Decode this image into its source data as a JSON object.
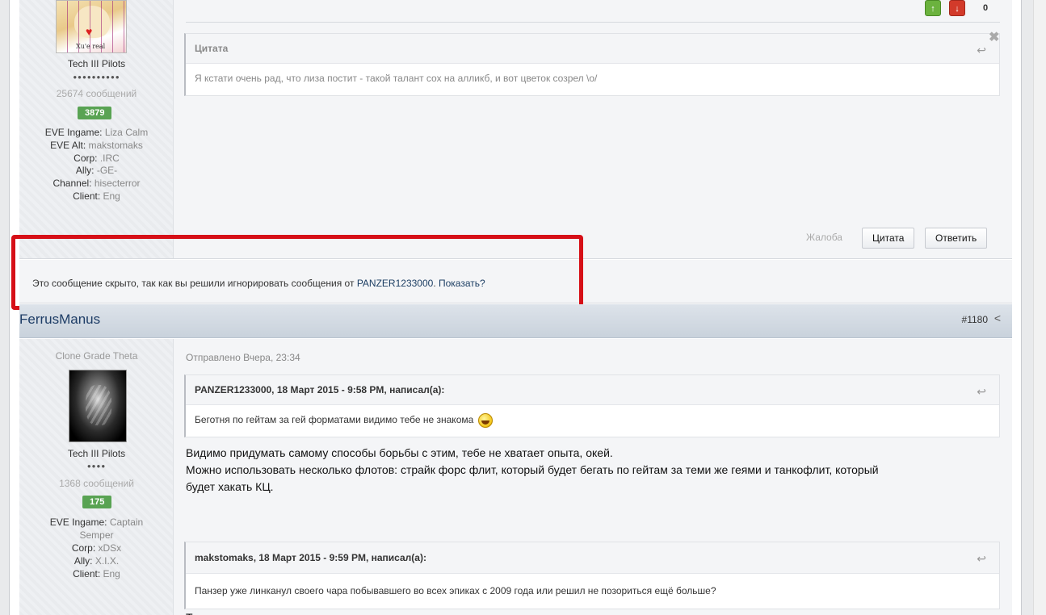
{
  "post1": {
    "votes": {
      "up_icon": "arrow-up-icon",
      "down_icon": "arrow-down-icon",
      "count": "0"
    },
    "author": {
      "group": "Tech III Pilots",
      "pips": "●●●●●●●●●●",
      "posts": "25674 сообщений",
      "reputation": "3879",
      "fields": [
        {
          "key": "EVE Ingame:",
          "value": "Liza Calm"
        },
        {
          "key": "EVE Alt:",
          "value": "makstomaks"
        },
        {
          "key": "Corp:",
          "value": ".IRC"
        },
        {
          "key": "Ally:",
          "value": "-GE-"
        },
        {
          "key": "Channel:",
          "value": "hisecterror"
        },
        {
          "key": "Client:",
          "value": "Eng"
        }
      ]
    },
    "quote": {
      "title": "Цитата",
      "text": "Я кстати очень рад, что лиза постит - такой талант сох на алликб, и вот цветок созрел \\o/"
    },
    "actions": {
      "report": "Жалоба",
      "quote": "Цитата",
      "reply": "Ответить"
    }
  },
  "hidden_notice": {
    "text": "Это сообщение скрыто, так как вы решили игнорировать сообщения от ",
    "user": "PANZER1233000",
    "separator": ". ",
    "show_link": "Показать?"
  },
  "post2": {
    "author_name": "FerrusManus",
    "post_number": "#1180",
    "share_icon": "share-icon",
    "author": {
      "rank": "Clone Grade Theta",
      "group": "Tech III Pilots",
      "pips": "●●●●",
      "posts": "1368 сообщений",
      "reputation": "175",
      "fields": [
        {
          "key": "EVE Ingame:",
          "value": "Captain"
        },
        {
          "key": "",
          "value": "Semper"
        },
        {
          "key": "Corp:",
          "value": "xDSx"
        },
        {
          "key": "Ally:",
          "value": "X.I.X."
        },
        {
          "key": "Client:",
          "value": "Eng"
        }
      ]
    },
    "posted": "Отправлено Вчера, 23:34",
    "quote1": {
      "title": "PANZER1233000, 18 Март 2015 - 9:58 PM, написал(а):",
      "text": "Беготня по гейтам за гей форматами видимо тебе не знакома"
    },
    "paragraph": [
      "Видимо придумать самому способы борьбы с этим, тебе не хватает опыта, окей.",
      "Можно использовать несколько флотов: страйк форс флит, который будет бегать по гейтам за теми же геями и танкофлит, который",
      "будет хакать КЦ."
    ],
    "quote2": {
      "title": "makstomaks, 18 Март 2015 - 9:59 PM, написал(а):",
      "text": "Панзер уже линканул своего чара побывавшего во всех эпиках с 2009 года или решил не позориться ещё больше?"
    },
    "trailing": "Т"
  }
}
